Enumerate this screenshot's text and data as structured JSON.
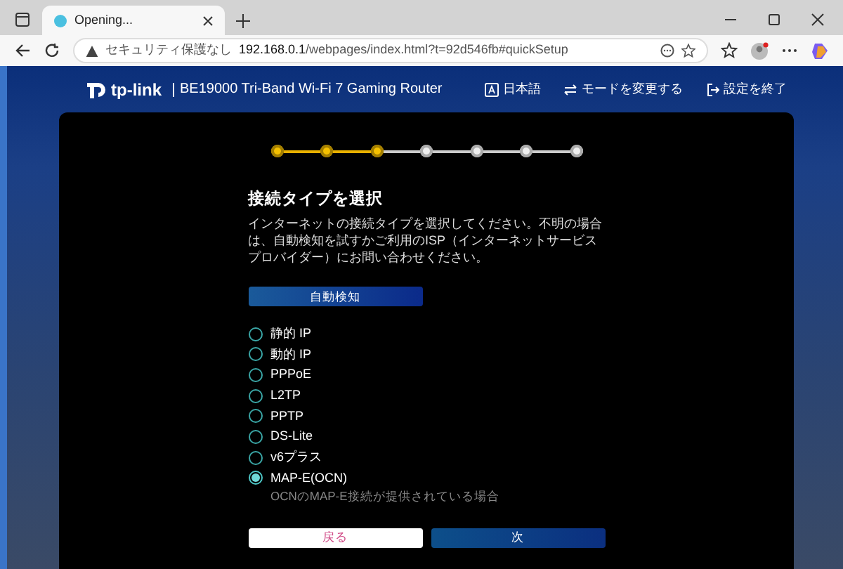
{
  "browser": {
    "tab_title": "Opening...",
    "security_label": "セキュリティ保護なし",
    "url_host": "192.168.0.1",
    "url_path": "/webpages/index.html?t=92d546fb#quickSetup"
  },
  "header": {
    "logo_text": "tp-link",
    "product": "BE19000 Tri-Band Wi-Fi 7 Gaming Router",
    "actions": [
      {
        "kind": "language",
        "label": "日本語"
      },
      {
        "kind": "mode",
        "label": "モードを変更する"
      },
      {
        "kind": "exit",
        "label": "設定を終了"
      }
    ]
  },
  "steps": [
    {
      "done": true
    },
    {
      "done": true
    },
    {
      "done": true
    },
    {
      "done": false
    },
    {
      "done": false
    },
    {
      "done": false
    },
    {
      "done": false
    }
  ],
  "title": "接続タイプを選択",
  "description": "インターネットの接続タイプを選択してください。不明の場合は、自動検知を試すかご利用のISP（インターネットサービスプロバイダー）にお問い合わせください。",
  "auto_detect_button": "自動検知",
  "options": [
    {
      "label": "静的 IP",
      "selected": false
    },
    {
      "label": "動的 IP",
      "selected": false
    },
    {
      "label": "PPPoE",
      "selected": false
    },
    {
      "label": "L2TP",
      "selected": false
    },
    {
      "label": "PPTP",
      "selected": false
    },
    {
      "label": "DS-Lite",
      "selected": false
    },
    {
      "label": "v6プラス",
      "selected": false
    },
    {
      "label": "MAP-E(OCN)",
      "selected": true,
      "note": "OCNのMAP-E接続が提供されている場合"
    }
  ],
  "back_button": "戻る",
  "next_button": "次"
}
